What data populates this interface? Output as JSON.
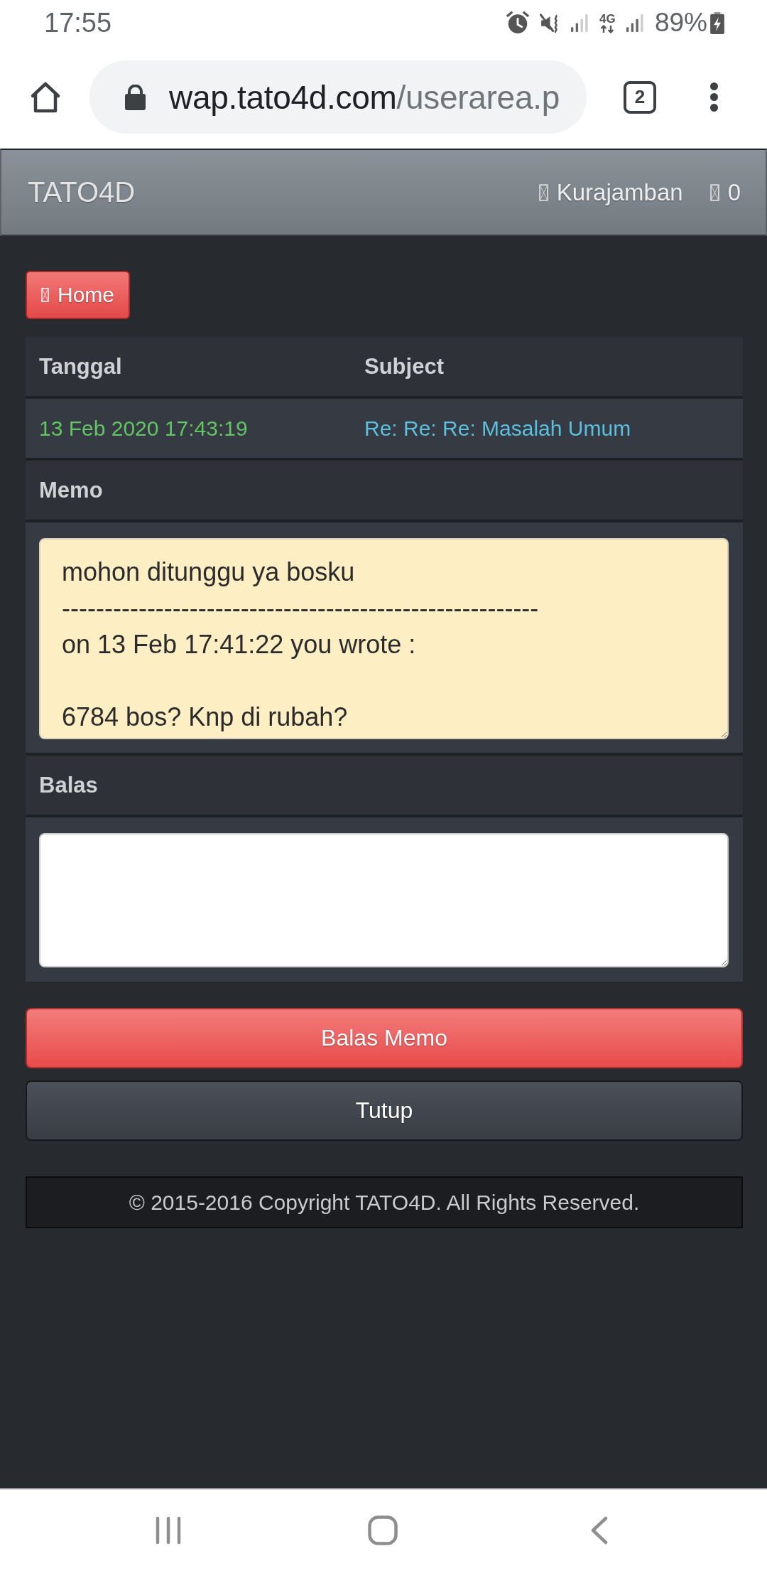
{
  "status_bar": {
    "time": "17:55",
    "network": "4G",
    "battery": "89%"
  },
  "browser": {
    "url_host": "wap.tato4d.com",
    "url_path": "/userarea.p",
    "tab_count": "2"
  },
  "header": {
    "brand": "TATO4D",
    "user": "Kurajamban",
    "count": "0"
  },
  "home_button": {
    "label": "Home"
  },
  "table": {
    "columns": [
      "Tanggal",
      "Subject"
    ],
    "rows": [
      {
        "date": "13 Feb 2020 17:43:19",
        "subject": "Re: Re: Re: Masalah Umum"
      }
    ]
  },
  "memo": {
    "label": "Memo",
    "paragraphs": [
      [
        "mohon ditunggu ya bosku",
        "--------------------------------------------------------",
        "on 13 Feb 17:41:22 you wrote :"
      ],
      [
        "6784 bos? Knp di rubah?"
      ]
    ]
  },
  "reply": {
    "label": "Balas"
  },
  "buttons": [
    {
      "label": "Balas Memo",
      "kind": "primary"
    },
    {
      "label": "Tutup",
      "kind": "default"
    }
  ],
  "footer": {
    "text": "© 2015-2016 Copyright TATO4D. All Rights Reserved."
  }
}
